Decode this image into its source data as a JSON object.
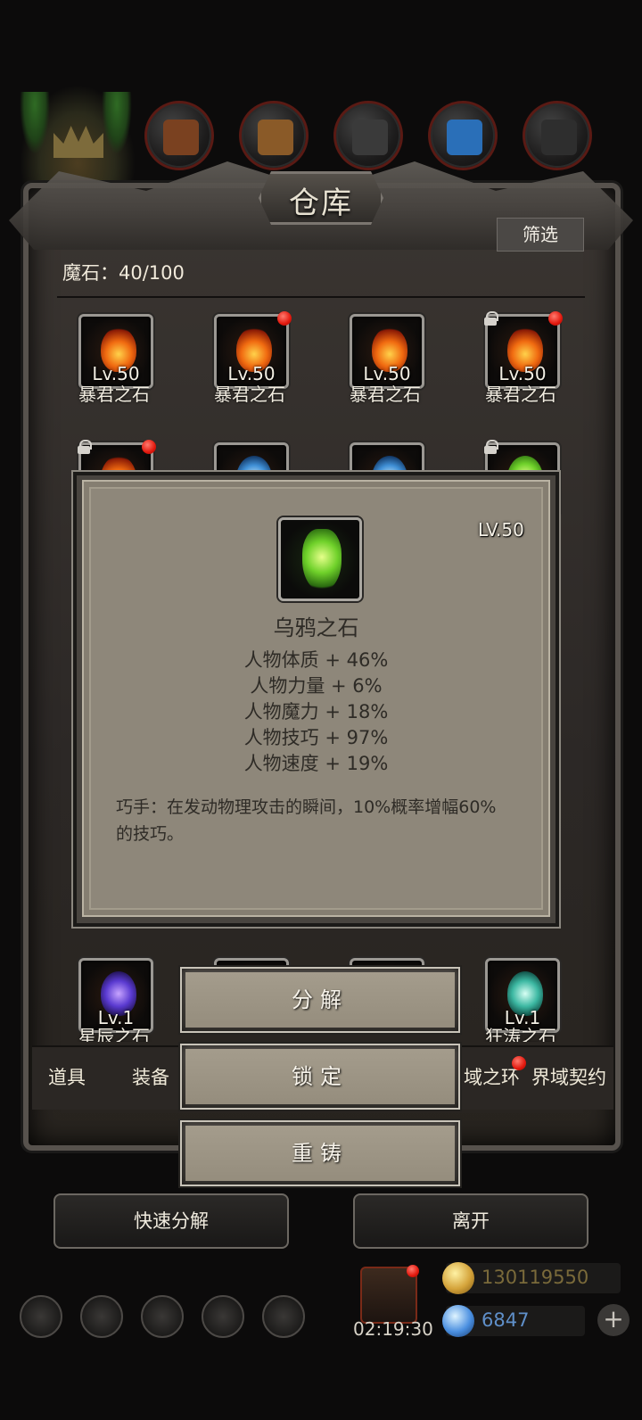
{
  "panel": {
    "title": "仓库",
    "filter_label": "筛选",
    "demon_stone_count": "魔石：40/100"
  },
  "grid": [
    {
      "level": "Lv.50",
      "name": "暴君之石",
      "gem": "fire",
      "red_dot": false,
      "locked": false
    },
    {
      "level": "Lv.50",
      "name": "暴君之石",
      "gem": "fire",
      "red_dot": true,
      "locked": false
    },
    {
      "level": "Lv.50",
      "name": "暴君之石",
      "gem": "fire",
      "red_dot": false,
      "locked": false
    },
    {
      "level": "Lv.50",
      "name": "暴君之石",
      "gem": "fire",
      "red_dot": true,
      "locked": true
    }
  ],
  "bottom_row": [
    {
      "level": "Lv.1",
      "name": "星辰之石",
      "gem": "purple"
    },
    {
      "level": "Lv.1",
      "name": "狂涛之石",
      "gem": "teal"
    }
  ],
  "categories": [
    "道具",
    "装备",
    "域之环",
    "界域契约"
  ],
  "tooltip": {
    "level": "LV.50",
    "name": "乌鸦之石",
    "icon": "green-crystal-icon",
    "stats": [
      "人物体质 + 46%",
      "人物力量 + 6%",
      "人物魔力 + 18%",
      "人物技巧 + 97%",
      "人物速度 + 19%"
    ],
    "description": "巧手：在发动物理攻击的瞬间，10%概率增幅60%的技巧。"
  },
  "actions": {
    "decompose": "分解",
    "lock": "锁定",
    "reforge": "重铸"
  },
  "bottom_buttons": {
    "quick_decompose": "快速分解",
    "leave": "离开"
  },
  "footer": {
    "timer": "02:19:30",
    "gold": "130119550",
    "diamonds": "6847"
  },
  "colors": {
    "gold_text": "#7a6a3a",
    "diamond_text": "#5f8fc9",
    "notify_red": "#e2180d"
  }
}
